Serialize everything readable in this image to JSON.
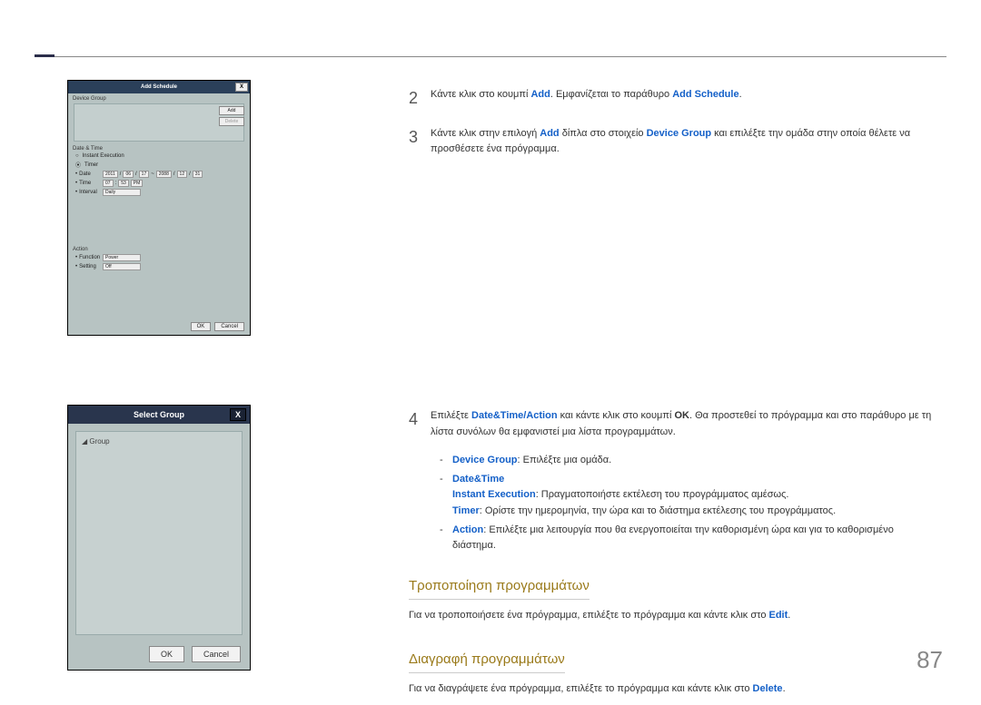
{
  "page_number": "87",
  "fig1": {
    "title": "Add Schedule",
    "close": "X",
    "section_device_group": "Device Group",
    "btn_add": "Add",
    "btn_delete": "Delete",
    "section_datetime": "Date & Time",
    "instant": "Instant Execution",
    "timer": "Timer",
    "date_lbl": "Date",
    "date_from_y": "2011",
    "date_from_m": "06",
    "date_from_d": "17",
    "date_sep": "~",
    "date_to_y": "2088",
    "date_to_m": "12",
    "date_to_d": "31",
    "time_lbl": "Time",
    "time_h": "07",
    "time_m": "53",
    "time_ampm": "PM",
    "interval_lbl": "Interval",
    "interval_val": "Daily",
    "section_action": "Action",
    "function_lbl": "Function",
    "function_val": "Power",
    "setting_lbl": "Setting",
    "setting_val": "Off",
    "ok": "OK",
    "cancel": "Cancel"
  },
  "fig2": {
    "title": "Select Group",
    "close": "X",
    "tree_root": "Group",
    "ok": "OK",
    "cancel": "Cancel"
  },
  "steps": {
    "s2": {
      "num": "2",
      "pre": "Κάντε κλικ στο κουμπί ",
      "add": "Add",
      "mid": ". Εμφανίζεται το παράθυρο ",
      "win": "Add Schedule",
      "post": "."
    },
    "s3": {
      "num": "3",
      "pre": "Κάντε κλικ στην επιλογή ",
      "add": "Add",
      "mid": " δίπλα στο στοιχείο ",
      "dg": "Device Group",
      "post": " και επιλέξτε την ομάδα στην οποία θέλετε να προσθέσετε ένα πρόγραμμα."
    },
    "s4": {
      "num": "4",
      "pre": "Επιλέξτε ",
      "dta": "Date&Time/Action",
      "mid": " και κάντε κλικ στο κουμπί ",
      "ok": "OK",
      "post": ". Θα προστεθεί το πρόγραμμα και στο παράθυρο με τη λίστα συνόλων θα εμφανιστεί μια λίστα προγραμμάτων."
    }
  },
  "bullets": {
    "b1_key": "Device Group",
    "b1_txt": ": Επιλέξτε μια ομάδα.",
    "b2_key": "Date&Time",
    "b2_inst_key": "Instant Execution",
    "b2_inst_txt": ": Πραγματοποιήστε εκτέλεση του προγράμματος αμέσως.",
    "b2_timer_key": "Timer",
    "b2_timer_txt": ": Ορίστε την ημερομηνία, την ώρα και το διάστημα εκτέλεσης του προγράμματος.",
    "b3_key": "Action",
    "b3_txt": ": Επιλέξτε μια λειτουργία που θα ενεργοποιείται την καθορισμένη ώρα και για το καθορισμένο διάστημα."
  },
  "sections": {
    "modify_heading": "Τροποποίηση προγραμμάτων",
    "modify_pre": "Για να τροποποιήσετε ένα πρόγραμμα, επιλέξτε το πρόγραμμα και κάντε κλικ στο ",
    "modify_btn": "Edit",
    "modify_post": ".",
    "delete_heading": "Διαγραφή προγραμμάτων",
    "delete_pre": "Για να διαγράψετε ένα πρόγραμμα, επιλέξτε το πρόγραμμα και κάντε κλικ στο ",
    "delete_btn": "Delete",
    "delete_post": "."
  }
}
